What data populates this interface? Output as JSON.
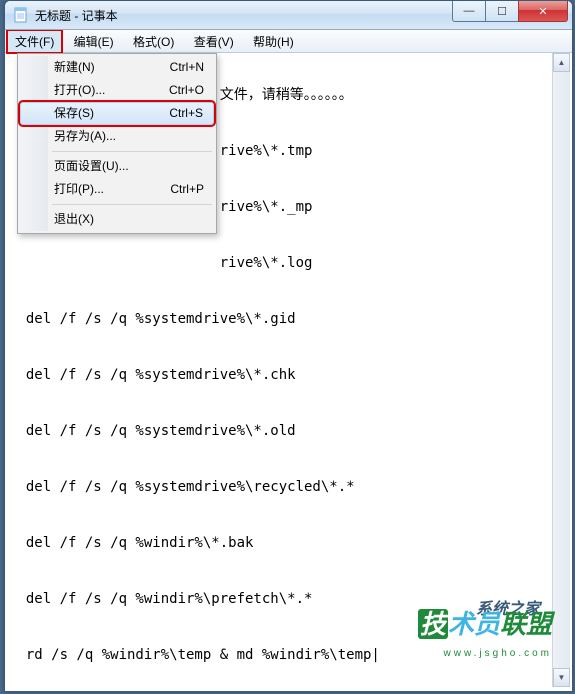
{
  "window": {
    "title": "无标题 - 记事本"
  },
  "menubar": {
    "items": [
      {
        "label": "文件(F)"
      },
      {
        "label": "编辑(E)"
      },
      {
        "label": "格式(O)"
      },
      {
        "label": "查看(V)"
      },
      {
        "label": "帮助(H)"
      }
    ]
  },
  "dropdown": {
    "items": [
      {
        "label": "新建(N)",
        "shortcut": "Ctrl+N"
      },
      {
        "label": "打开(O)...",
        "shortcut": "Ctrl+O"
      },
      {
        "label": "保存(S)",
        "shortcut": "Ctrl+S"
      },
      {
        "label": "另存为(A)...",
        "shortcut": ""
      },
      {
        "sep": true
      },
      {
        "label": "页面设置(U)...",
        "shortcut": ""
      },
      {
        "label": "打印(P)...",
        "shortcut": "Ctrl+P"
      },
      {
        "sep": true
      },
      {
        "label": "退出(X)",
        "shortcut": ""
      }
    ]
  },
  "winbtns": {
    "min": "—",
    "max": "☐",
    "close": "✕"
  },
  "content": "\n                         文件，请稍等。。。。。。\n\n                         rive%\\*.tmp\n\n                         rive%\\*._mp\n\n                         rive%\\*.log\n\n  del /f /s /q %systemdrive%\\*.gid\n\n  del /f /s /q %systemdrive%\\*.chk\n\n  del /f /s /q %systemdrive%\\*.old\n\n  del /f /s /q %systemdrive%\\recycled\\*.*\n\n  del /f /s /q %windir%\\*.bak\n\n  del /f /s /q %windir%\\prefetch\\*.*\n\n  rd /s /q %windir%\\temp & md %windir%\\temp|\n\n  del /f /q %userprofile%\\cookies\\*.*\n\n  del /f /q %userprofile%\\recent\\*.*\n\n  del /f /s /q \"%userprofile%\\Local Settings\\Temporary Internet\nFiles\\*.*\"\n\n  del /f /s /q \"%userprofile%\\Local Settings\\Temp\\*.*\"\n\n  del /f /s /q \"%userprofile%\\recent\\*.*\"\n\n  echo 系统垃圾清除完毕！\n\n  echo. & pause",
  "watermark": {
    "brand_a": "技",
    "brand_b": "术员",
    "brand_c": "联盟",
    "url": "www.jsgho.com",
    "brand2": "系统之家"
  },
  "scroll": {
    "up": "▲",
    "down": "▼"
  }
}
